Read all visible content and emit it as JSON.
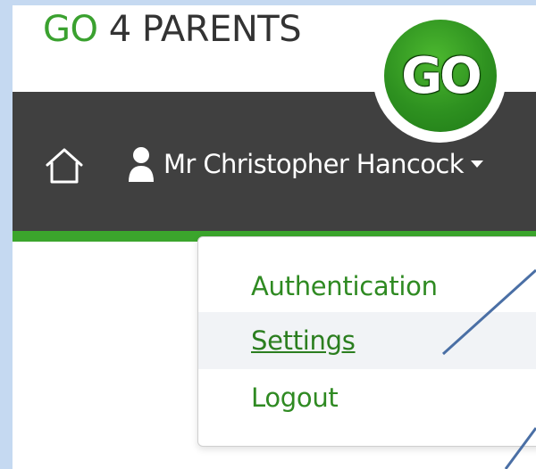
{
  "brand": {
    "go": "GO",
    "rest": " 4 PARENTS"
  },
  "logo": {
    "text": "GO",
    "color": "#2e9120"
  },
  "nav": {
    "home_icon": "home-icon",
    "user_icon": "user-icon",
    "user_name": "Mr Christopher Hancock",
    "background": "#404040",
    "accent": "#3ba52c"
  },
  "dropdown": {
    "items": [
      {
        "label": "Authentication"
      },
      {
        "label": "Settings"
      },
      {
        "label": "Logout"
      }
    ],
    "highlighted": "Settings",
    "item_color": "#2f8a22"
  }
}
